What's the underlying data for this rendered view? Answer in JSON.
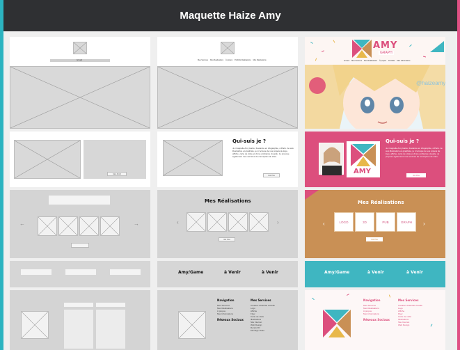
{
  "window": {
    "title": "Maquette Haize Amy"
  },
  "wireframe_v1": {
    "header_nav": "Accueil",
    "about_button": "Mon Profil",
    "realisations_button": "",
    "footer": {}
  },
  "wireframe_v2": {
    "nav_items": [
      "Mes Services",
      "Mes Réalisations",
      "À propos",
      "Portfolio Réalisations",
      "Mes Réalisations"
    ],
    "about_title": "Qui-suis je ?",
    "about_text": "Je m'appelle Amy Haize, freelance en infographie, à Paris. Je suis illustratrice et graphiste, je m'occupe de vos projets de logo, affiche, carte de visite et d'une ambiance visuelle. Je propose également mes services de conception de sites.",
    "about_button": "Voir Plus",
    "realisations_title": "Mes Réalisations",
    "realisations_button": "Voir Plus",
    "bar_items": [
      "Amy/Game",
      "à Venir",
      "à Venir"
    ],
    "footer_nav_title": "Navigation",
    "footer_nav_items": [
      "Mes Services",
      "Mes Réalisations",
      "À propos",
      "Mes Informations"
    ],
    "footer_services_title": "Mes Services",
    "footer_services_items": [
      "Création d'identité visuelle",
      "Logo",
      "Affiche",
      "Flyer",
      "Carte de visite",
      "Illustrations",
      "Site Internet",
      "Web Design",
      "Rendu 3D",
      "Montage Vidéo"
    ],
    "footer_social_title": "Réseaux Sociaux"
  },
  "final_design": {
    "logo_text": "AMY",
    "logo_sub": "GRAPH",
    "nav_items": [
      "Accueil",
      "Mes Services",
      "Mes Réalisations",
      "À propos",
      "Portfolio",
      "Mes Informations"
    ],
    "watermark": "@haizeamy",
    "about_title": "Qui-suis je ?",
    "about_logo_text": "AMY",
    "about_button": "Voir Plus",
    "realisations_title": "Mes Réalisations",
    "cards": [
      "LOGO",
      "3D",
      "PUB",
      "GRAPH"
    ],
    "realisations_button": "Voir Plus",
    "bar_items": [
      "Amy/Game",
      "à Venir",
      "à Venir"
    ],
    "footer_nav_title": "Navigation",
    "footer_services_title": "Mes Services",
    "footer_social_title": "Réseaux Sociaux"
  },
  "colors": {
    "titlebar": "#2f3033",
    "pink": "#dc4f7d",
    "ochre": "#c99055",
    "teal": "#3fb6c1"
  }
}
